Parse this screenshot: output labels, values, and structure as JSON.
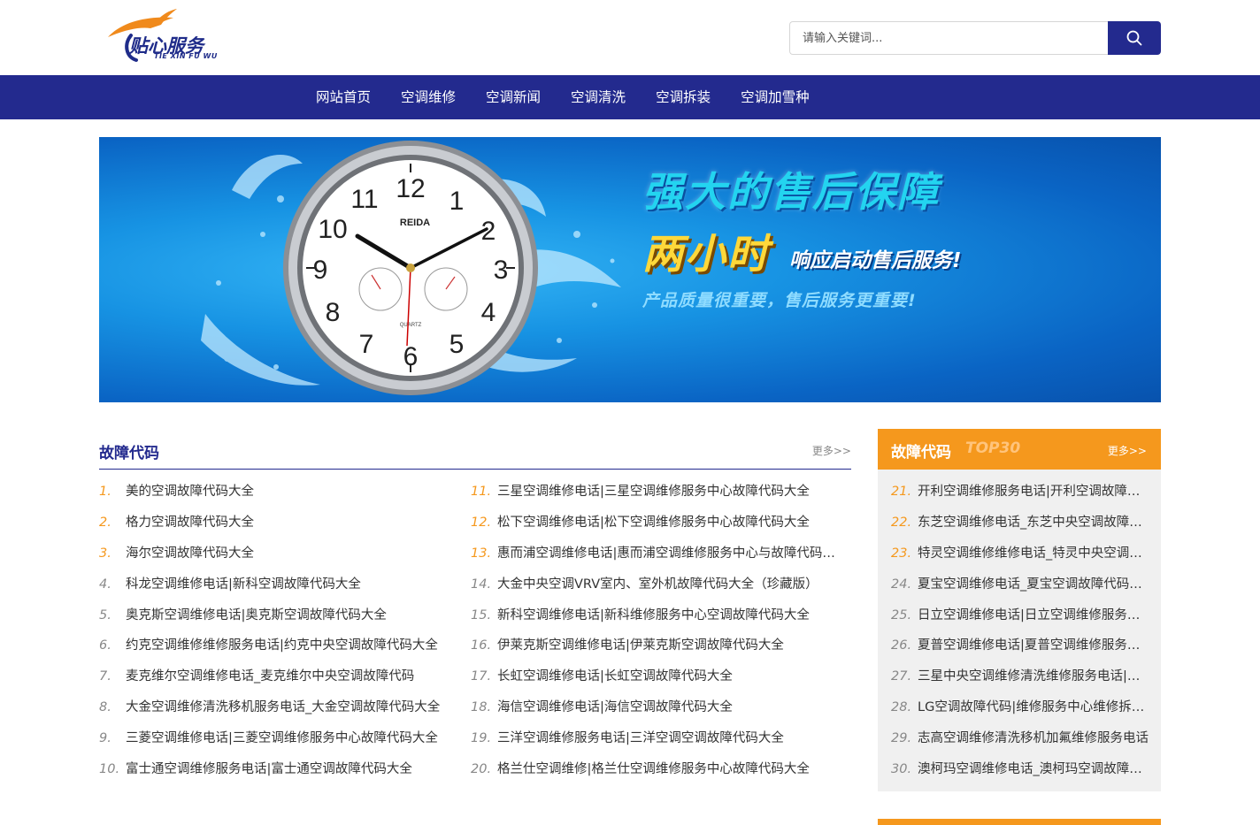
{
  "logo": {
    "text": "贴心服务",
    "sub": "TIE XIN FU WU",
    "colors": {
      "swoosh": "#f08a1c",
      "text": "#1f2c8a"
    }
  },
  "search": {
    "placeholder": "请输入关键词...",
    "icon": "search-icon"
  },
  "nav": {
    "items": [
      "网站首页",
      "空调维修",
      "空调新闻",
      "空调清洗",
      "空调拆装",
      "空调加雪种"
    ]
  },
  "banner": {
    "line1": "强大的售后保障",
    "line2": "两小时",
    "line2_sub": "响应启动售后服务!",
    "line3": "产品质量很重要，售后服务更重要!",
    "clock_brand": "REIDA",
    "clock_label": "QUARTZ",
    "clock_numbers": [
      "12",
      "1",
      "2",
      "3",
      "4",
      "5",
      "6",
      "7",
      "8",
      "9",
      "10",
      "11"
    ]
  },
  "left_section": {
    "title": "故障代码",
    "more": "更多>>",
    "col1": [
      {
        "num": "1.",
        "text": "美的空调故障代码大全"
      },
      {
        "num": "2.",
        "text": "格力空调故障代码大全"
      },
      {
        "num": "3.",
        "text": "海尔空调故障代码大全"
      },
      {
        "num": "4.",
        "text": "科龙空调维修电话|新科空调故障代码大全"
      },
      {
        "num": "5.",
        "text": "奥克斯空调维修电话|奥克斯空调故障代码大全"
      },
      {
        "num": "6.",
        "text": "约克空调维修维修服务电话|约克中央空调故障代码大全"
      },
      {
        "num": "7.",
        "text": "麦克维尔空调维修电话_麦克维尔中央空调故障代码"
      },
      {
        "num": "8.",
        "text": "大金空调维修清洗移机服务电话_大金空调故障代码大全"
      },
      {
        "num": "9.",
        "text": "三菱空调维修电话|三菱空调维修服务中心故障代码大全"
      },
      {
        "num": "10.",
        "text": "富士通空调维修服务电话|富士通空调故障代码大全"
      }
    ],
    "col2": [
      {
        "num": "11.",
        "text": "三星空调维修电话|三星空调维修服务中心故障代码大全"
      },
      {
        "num": "12.",
        "text": "松下空调维修电话|松下空调维修服务中心故障代码大全"
      },
      {
        "num": "13.",
        "text": "惠而浦空调维修电话|惠而浦空调维修服务中心与故障代码大全"
      },
      {
        "num": "14.",
        "text": "大金中央空调VRV室内、室外机故障代码大全（珍藏版）"
      },
      {
        "num": "15.",
        "text": "新科空调维修电话|新科维修服务中心空调故障代码大全"
      },
      {
        "num": "16.",
        "text": "伊莱克斯空调维修电话|伊莱克斯空调故障代码大全"
      },
      {
        "num": "17.",
        "text": "长虹空调维修电话|长虹空调故障代码大全"
      },
      {
        "num": "18.",
        "text": "海信空调维修电话|海信空调故障代码大全"
      },
      {
        "num": "19.",
        "text": "三洋空调维修服务电话|三洋空调空调故障代码大全"
      },
      {
        "num": "20.",
        "text": "格兰仕空调维修|格兰仕空调维修服务中心故障代码大全"
      }
    ]
  },
  "right_section": {
    "title": "故障代码",
    "top": "TOP30",
    "more": "更多>>",
    "items": [
      {
        "num": "21.",
        "text": "开利空调维修服务电话|开利空调故障代码大全"
      },
      {
        "num": "22.",
        "text": "东芝空调维修电话_东芝中央空调故障代码大全"
      },
      {
        "num": "23.",
        "text": "特灵空调维修维修电话_特灵中央空调故障代码"
      },
      {
        "num": "24.",
        "text": "夏宝空调维修电话_夏宝空调故障代码大全"
      },
      {
        "num": "25.",
        "text": "日立空调维修电话|日立空调维修服务中心故障代码"
      },
      {
        "num": "26.",
        "text": "夏普空调维修电话|夏普空调维修服务中心故障代码"
      },
      {
        "num": "27.",
        "text": "三星中央空调维修清洗维修服务电话|故障代码"
      },
      {
        "num": "28.",
        "text": "LG空调故障代码|维修服务中心维修拆装电话"
      },
      {
        "num": "29.",
        "text": "志高空调维修清洗移机加氟维修服务电话"
      },
      {
        "num": "30.",
        "text": "澳柯玛空调维修电话_澳柯玛空调故障代码大全"
      }
    ]
  },
  "colors": {
    "primary": "#232a8e",
    "accent": "#f5981d",
    "highlight_num": "#f5981d",
    "muted_num": "#888888"
  }
}
